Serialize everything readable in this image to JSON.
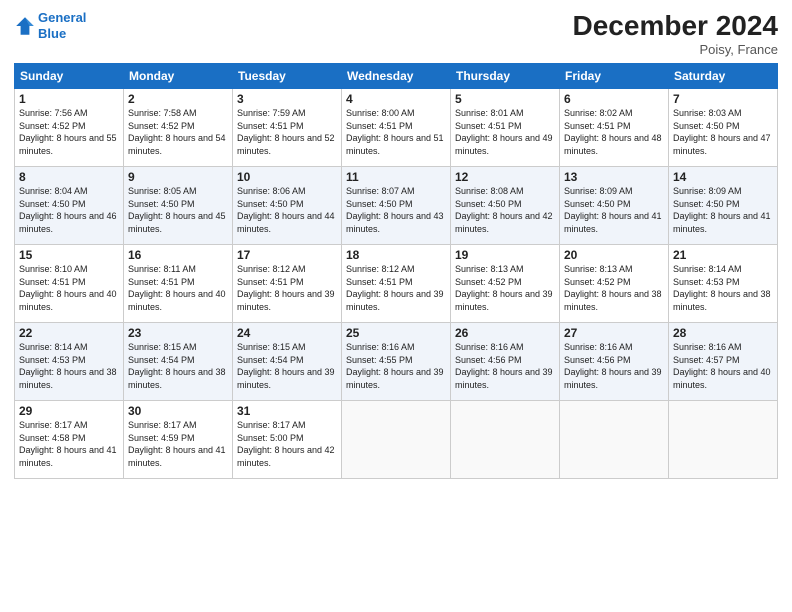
{
  "header": {
    "logo_line1": "General",
    "logo_line2": "Blue",
    "month": "December 2024",
    "location": "Poisy, France"
  },
  "days_of_week": [
    "Sunday",
    "Monday",
    "Tuesday",
    "Wednesday",
    "Thursday",
    "Friday",
    "Saturday"
  ],
  "weeks": [
    [
      {
        "day": "1",
        "sunrise": "Sunrise: 7:56 AM",
        "sunset": "Sunset: 4:52 PM",
        "daylight": "Daylight: 8 hours and 55 minutes."
      },
      {
        "day": "2",
        "sunrise": "Sunrise: 7:58 AM",
        "sunset": "Sunset: 4:52 PM",
        "daylight": "Daylight: 8 hours and 54 minutes."
      },
      {
        "day": "3",
        "sunrise": "Sunrise: 7:59 AM",
        "sunset": "Sunset: 4:51 PM",
        "daylight": "Daylight: 8 hours and 52 minutes."
      },
      {
        "day": "4",
        "sunrise": "Sunrise: 8:00 AM",
        "sunset": "Sunset: 4:51 PM",
        "daylight": "Daylight: 8 hours and 51 minutes."
      },
      {
        "day": "5",
        "sunrise": "Sunrise: 8:01 AM",
        "sunset": "Sunset: 4:51 PM",
        "daylight": "Daylight: 8 hours and 49 minutes."
      },
      {
        "day": "6",
        "sunrise": "Sunrise: 8:02 AM",
        "sunset": "Sunset: 4:51 PM",
        "daylight": "Daylight: 8 hours and 48 minutes."
      },
      {
        "day": "7",
        "sunrise": "Sunrise: 8:03 AM",
        "sunset": "Sunset: 4:50 PM",
        "daylight": "Daylight: 8 hours and 47 minutes."
      }
    ],
    [
      {
        "day": "8",
        "sunrise": "Sunrise: 8:04 AM",
        "sunset": "Sunset: 4:50 PM",
        "daylight": "Daylight: 8 hours and 46 minutes."
      },
      {
        "day": "9",
        "sunrise": "Sunrise: 8:05 AM",
        "sunset": "Sunset: 4:50 PM",
        "daylight": "Daylight: 8 hours and 45 minutes."
      },
      {
        "day": "10",
        "sunrise": "Sunrise: 8:06 AM",
        "sunset": "Sunset: 4:50 PM",
        "daylight": "Daylight: 8 hours and 44 minutes."
      },
      {
        "day": "11",
        "sunrise": "Sunrise: 8:07 AM",
        "sunset": "Sunset: 4:50 PM",
        "daylight": "Daylight: 8 hours and 43 minutes."
      },
      {
        "day": "12",
        "sunrise": "Sunrise: 8:08 AM",
        "sunset": "Sunset: 4:50 PM",
        "daylight": "Daylight: 8 hours and 42 minutes."
      },
      {
        "day": "13",
        "sunrise": "Sunrise: 8:09 AM",
        "sunset": "Sunset: 4:50 PM",
        "daylight": "Daylight: 8 hours and 41 minutes."
      },
      {
        "day": "14",
        "sunrise": "Sunrise: 8:09 AM",
        "sunset": "Sunset: 4:50 PM",
        "daylight": "Daylight: 8 hours and 41 minutes."
      }
    ],
    [
      {
        "day": "15",
        "sunrise": "Sunrise: 8:10 AM",
        "sunset": "Sunset: 4:51 PM",
        "daylight": "Daylight: 8 hours and 40 minutes."
      },
      {
        "day": "16",
        "sunrise": "Sunrise: 8:11 AM",
        "sunset": "Sunset: 4:51 PM",
        "daylight": "Daylight: 8 hours and 40 minutes."
      },
      {
        "day": "17",
        "sunrise": "Sunrise: 8:12 AM",
        "sunset": "Sunset: 4:51 PM",
        "daylight": "Daylight: 8 hours and 39 minutes."
      },
      {
        "day": "18",
        "sunrise": "Sunrise: 8:12 AM",
        "sunset": "Sunset: 4:51 PM",
        "daylight": "Daylight: 8 hours and 39 minutes."
      },
      {
        "day": "19",
        "sunrise": "Sunrise: 8:13 AM",
        "sunset": "Sunset: 4:52 PM",
        "daylight": "Daylight: 8 hours and 39 minutes."
      },
      {
        "day": "20",
        "sunrise": "Sunrise: 8:13 AM",
        "sunset": "Sunset: 4:52 PM",
        "daylight": "Daylight: 8 hours and 38 minutes."
      },
      {
        "day": "21",
        "sunrise": "Sunrise: 8:14 AM",
        "sunset": "Sunset: 4:53 PM",
        "daylight": "Daylight: 8 hours and 38 minutes."
      }
    ],
    [
      {
        "day": "22",
        "sunrise": "Sunrise: 8:14 AM",
        "sunset": "Sunset: 4:53 PM",
        "daylight": "Daylight: 8 hours and 38 minutes."
      },
      {
        "day": "23",
        "sunrise": "Sunrise: 8:15 AM",
        "sunset": "Sunset: 4:54 PM",
        "daylight": "Daylight: 8 hours and 38 minutes."
      },
      {
        "day": "24",
        "sunrise": "Sunrise: 8:15 AM",
        "sunset": "Sunset: 4:54 PM",
        "daylight": "Daylight: 8 hours and 39 minutes."
      },
      {
        "day": "25",
        "sunrise": "Sunrise: 8:16 AM",
        "sunset": "Sunset: 4:55 PM",
        "daylight": "Daylight: 8 hours and 39 minutes."
      },
      {
        "day": "26",
        "sunrise": "Sunrise: 8:16 AM",
        "sunset": "Sunset: 4:56 PM",
        "daylight": "Daylight: 8 hours and 39 minutes."
      },
      {
        "day": "27",
        "sunrise": "Sunrise: 8:16 AM",
        "sunset": "Sunset: 4:56 PM",
        "daylight": "Daylight: 8 hours and 39 minutes."
      },
      {
        "day": "28",
        "sunrise": "Sunrise: 8:16 AM",
        "sunset": "Sunset: 4:57 PM",
        "daylight": "Daylight: 8 hours and 40 minutes."
      }
    ],
    [
      {
        "day": "29",
        "sunrise": "Sunrise: 8:17 AM",
        "sunset": "Sunset: 4:58 PM",
        "daylight": "Daylight: 8 hours and 41 minutes."
      },
      {
        "day": "30",
        "sunrise": "Sunrise: 8:17 AM",
        "sunset": "Sunset: 4:59 PM",
        "daylight": "Daylight: 8 hours and 41 minutes."
      },
      {
        "day": "31",
        "sunrise": "Sunrise: 8:17 AM",
        "sunset": "Sunset: 5:00 PM",
        "daylight": "Daylight: 8 hours and 42 minutes."
      },
      null,
      null,
      null,
      null
    ]
  ]
}
